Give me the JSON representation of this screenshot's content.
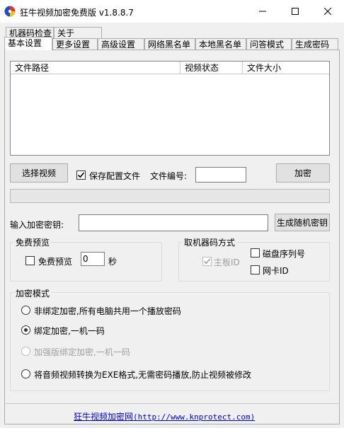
{
  "window": {
    "title": "狂牛视频加密免费版 v1.8.8.7",
    "minimize": "minimize",
    "maximize": "maximize",
    "close": "close"
  },
  "tabs_row1": [
    {
      "label": "机器码检查"
    },
    {
      "label": "关于"
    }
  ],
  "tabs_row2": [
    {
      "label": "基本设置"
    },
    {
      "label": "更多设置"
    },
    {
      "label": "高级设置"
    },
    {
      "label": "网络黑名单"
    },
    {
      "label": "本地黑名单"
    },
    {
      "label": "问答模式"
    },
    {
      "label": "生成密码"
    }
  ],
  "file_list": {
    "columns": [
      "文件路径",
      "视频状态",
      "文件大小"
    ]
  },
  "actions": {
    "select_video": "选择视频",
    "save_config": "保存配置文件",
    "save_config_checked": true,
    "file_number_label": "文件编号:",
    "file_number_value": "",
    "encrypt": "加密"
  },
  "progress": 0,
  "key": {
    "label": "输入加密密钥:",
    "value": "",
    "generate": "生成随机密钥"
  },
  "preview": {
    "group_label": "免费预览",
    "checkbox_label": "免费预览",
    "checked": false,
    "seconds_value": "0",
    "unit": "秒"
  },
  "machine_code": {
    "group_label": "取机器码方式",
    "options": [
      {
        "label": "主板ID",
        "checked": true,
        "disabled": true
      },
      {
        "label": "磁盘序列号",
        "checked": false,
        "disabled": false
      },
      {
        "label": "网卡ID",
        "checked": false,
        "disabled": false
      }
    ]
  },
  "mode": {
    "group_label": "加密模式",
    "options": [
      {
        "label": "非绑定加密,所有电脑共用一个播放密码",
        "selected": false,
        "disabled": false
      },
      {
        "label": "绑定加密,一机一码",
        "selected": true,
        "disabled": false
      },
      {
        "label": "加强版绑定加密,一机一码",
        "selected": false,
        "disabled": true
      },
      {
        "label": "将音频视频转换为EXE格式,无需密码播放,防止视频被修改",
        "selected": false,
        "disabled": false
      }
    ]
  },
  "footer": {
    "link_text": "狂牛视频加密网",
    "url_text": "(http://www.knprotect.com)"
  }
}
